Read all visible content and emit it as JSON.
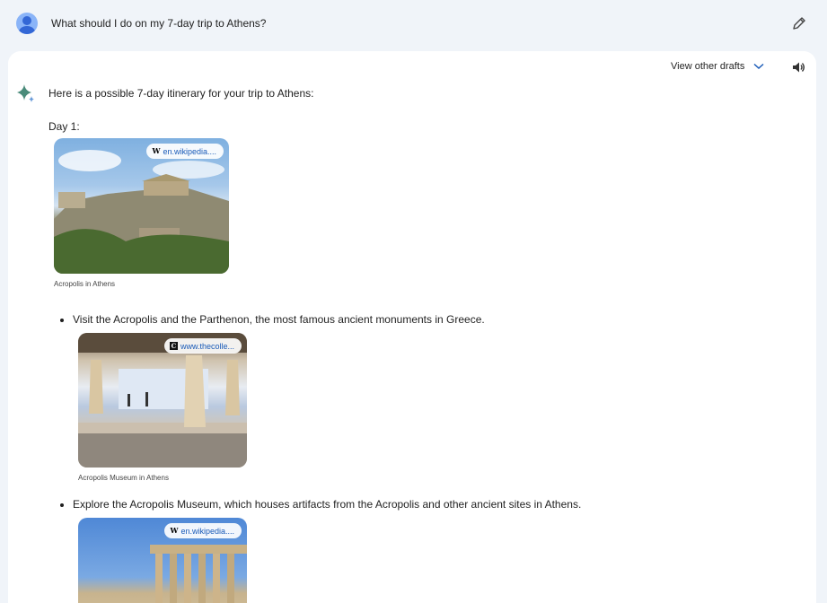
{
  "prompt": {
    "text": "What should I do on my 7-day trip to Athens?"
  },
  "response": {
    "drafts_label": "View other drafts",
    "intro": "Here is a possible 7-day itinerary for your trip to Athens:",
    "day_heading": "Day 1:",
    "cards": [
      {
        "source": "en.wikipedia....",
        "source_icon": "W",
        "caption": "Acropolis in Athens"
      },
      {
        "source": "www.thecolle...",
        "source_icon": "C",
        "caption": "Acropolis Museum in Athens"
      },
      {
        "source": "en.wikipedia....",
        "source_icon": "W",
        "caption": ""
      }
    ],
    "bullets": [
      "Visit the Acropolis and the Parthenon, the most famous ancient monuments in Greece.",
      "Explore the Acropolis Museum, which houses artifacts from the Acropolis and other ancient sites in Athens."
    ]
  },
  "icons": {
    "avatar": "user-avatar-icon",
    "edit": "pencil-icon",
    "drafts": "chevron-down-icon",
    "speaker": "speaker-icon",
    "assistant": "sparkle-icon"
  },
  "colors": {
    "page_bg": "#f0f4f9",
    "card_bg": "#ffffff",
    "link": "#1a5bb8",
    "chevron": "#1a5bb8"
  }
}
